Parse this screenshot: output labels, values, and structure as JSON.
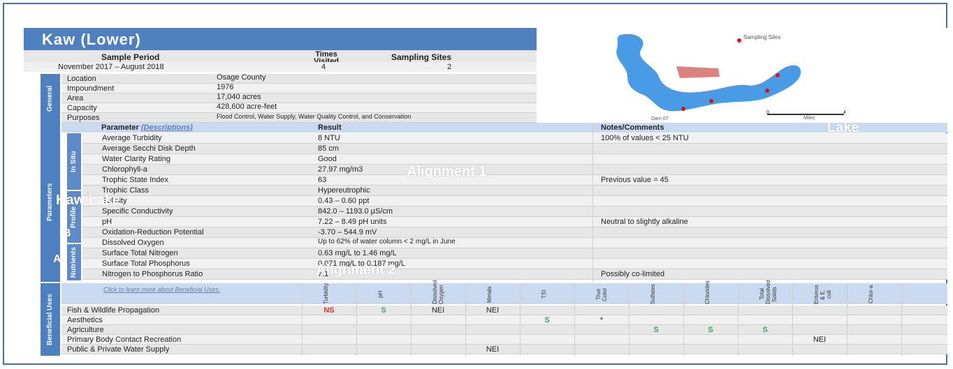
{
  "title": "Kaw (Lower)",
  "summary": {
    "headers": [
      "Sample Period",
      "Times Visited",
      "Sampling Sites"
    ],
    "values": [
      "November 2017 – August 2018",
      "4",
      "2"
    ]
  },
  "general": {
    "section_label": "General",
    "rows": [
      {
        "label": "Location",
        "value": "Osage County"
      },
      {
        "label": "Impoundment",
        "value": "1976"
      },
      {
        "label": "Area",
        "value": "17,040 acres"
      },
      {
        "label": "Capacity",
        "value": "428,600 acre-feet"
      },
      {
        "label": "Purposes",
        "value": "Flood Control, Water Supply, Water Quality Control, and Conservation"
      }
    ]
  },
  "map": {
    "legend": "Sampling Sites",
    "label_lake": "Lake",
    "label_dam": "Dam 07",
    "scale_left": "0",
    "scale_right": "4",
    "scale_unit": "Miles"
  },
  "parameters": {
    "section_label": "Parameters",
    "header_param": "Parameter",
    "header_desc_link": "(Descriptions)",
    "header_result": "Result",
    "header_notes": "Notes/Comments",
    "insitu_label": "In Situ",
    "profile_label": "Profile",
    "nutrients_label": "Nutrients",
    "rows": [
      {
        "param": "Average Turbidity",
        "result": "8 NTU",
        "note": "100% of values < 25 NTU"
      },
      {
        "param": "Average Secchi Disk Depth",
        "result": "85 cm",
        "note": ""
      },
      {
        "param": "Water Clarity Rating",
        "result": "Good",
        "note": ""
      },
      {
        "param": "Chlorophyll-a",
        "result": "27.97 mg/m3",
        "note": ""
      },
      {
        "param": "Trophic State Index",
        "result": "63",
        "note": "Previous value = 45"
      },
      {
        "param": "Trophic Class",
        "result": "Hypereutrophic",
        "note": ""
      },
      {
        "param": "Salinity",
        "result": "0.43 – 0.60 ppt",
        "note": ""
      },
      {
        "param": "Specific Conductivity",
        "result": "842.0 – 1193.0 µS/cm",
        "note": ""
      },
      {
        "param": "pH",
        "result": "7.22 – 8.49 pH units",
        "note": "Neutral to slightly alkaline"
      },
      {
        "param": "Oxidation-Reduction Potential",
        "result": "-3.70 – 544.9 mV",
        "note": ""
      },
      {
        "param": "Dissolved Oxygen",
        "result": "Up to 62% of water column < 2 mg/L in June",
        "note": ""
      },
      {
        "param": "Surface Total Nitrogen",
        "result": "0.63 mg/L to 1.46 mg/L",
        "note": ""
      },
      {
        "param": "Surface Total Phosphorus",
        "result": "0.071 mg/L to 0.187 mg/L",
        "note": ""
      },
      {
        "param": "Nitrogen to Phosphorus Ratio",
        "result": "7:1",
        "note": "Possibly co-limited"
      }
    ]
  },
  "beneficial": {
    "section_label": "Beneficial Uses",
    "link_text": "Click to learn more about Beneficial Uses.",
    "columns": [
      "Turbidity",
      "pH",
      "Dissolved Oxygen",
      "Metals",
      "TSI",
      "True Color",
      "Sulfates",
      "Chlorides",
      "Total Dissolved Solids",
      "Enteros & E. coli",
      "Chlor-a"
    ],
    "rows": [
      {
        "name": "Fish & Wildlife Propagation",
        "cells": [
          "NS",
          "S",
          "NEI",
          "NEI",
          "",
          "",
          "",
          "",
          "",
          "",
          ""
        ]
      },
      {
        "name": "Aesthetics",
        "cells": [
          "",
          "",
          "",
          "",
          "S",
          "*",
          "",
          "",
          "",
          "",
          ""
        ]
      },
      {
        "name": "Agriculture",
        "cells": [
          "",
          "",
          "",
          "",
          "",
          "",
          "S",
          "S",
          "S",
          "",
          ""
        ]
      },
      {
        "name": "Primary Body Contact Recreation",
        "cells": [
          "",
          "",
          "",
          "",
          "",
          "",
          "",
          "",
          "",
          "NEI",
          ""
        ]
      },
      {
        "name": "Public & Private Water Supply",
        "cells": [
          "",
          "",
          "",
          "NEI",
          "",
          "",
          "",
          "",
          "",
          "",
          ""
        ]
      }
    ]
  },
  "overlays": {
    "lake": "Lake",
    "alignment1": "Alignment 1",
    "alignment2": "Alignment 2",
    "kaw_lake": "Kaw Lake",
    "b": "B",
    "a": "A"
  },
  "colors": {
    "accent": "#4e7fbf",
    "ns": "#e0302a",
    "s": "#3aa55a"
  }
}
